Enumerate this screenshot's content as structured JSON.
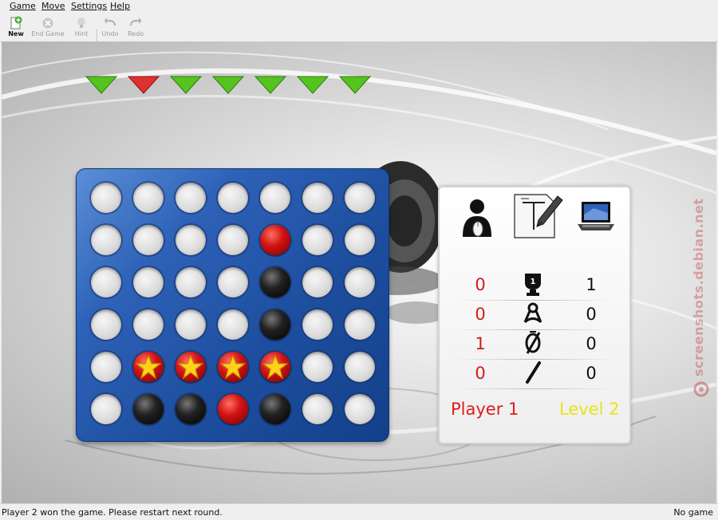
{
  "menu": {
    "items": [
      "Game",
      "Move",
      "Settings",
      "Help"
    ]
  },
  "toolbar": {
    "new_label": "New",
    "end_game_label": "End Game",
    "hint_label": "Hint",
    "undo_label": "Undo",
    "redo_label": "Redo"
  },
  "column_arrows": [
    "green",
    "red",
    "green",
    "green",
    "green",
    "green",
    "green"
  ],
  "colors": {
    "arrow_green": "#55c41e",
    "arrow_red": "#e03030",
    "player_red": "#d21b1b",
    "level_yellow": "#e8e41a",
    "board_blue": "#1d4e9f"
  },
  "board": {
    "rows": 6,
    "columns": 7,
    "cells": [
      [
        "empty",
        "empty",
        "empty",
        "empty",
        "empty",
        "empty",
        "empty"
      ],
      [
        "empty",
        "empty",
        "empty",
        "empty",
        "red",
        "empty",
        "empty"
      ],
      [
        "empty",
        "empty",
        "empty",
        "empty",
        "black",
        "empty",
        "empty"
      ],
      [
        "empty",
        "empty",
        "empty",
        "empty",
        "black",
        "empty",
        "empty"
      ],
      [
        "empty",
        "red-star",
        "red-star",
        "red-star",
        "red-star",
        "empty",
        "empty"
      ],
      [
        "empty",
        "black",
        "black",
        "red",
        "black",
        "empty",
        "empty"
      ]
    ]
  },
  "score_panel": {
    "player_icons": [
      "player-mouse-icon",
      "paper-pencil-icon",
      "computer-laptop-icon"
    ],
    "rows": [
      {
        "left": "0",
        "icon": "trophy-icon",
        "right": "1"
      },
      {
        "left": "0",
        "icon": "loss-ribbon-icon",
        "right": "0"
      },
      {
        "left": "1",
        "icon": "draw-zero-icon",
        "right": "0"
      },
      {
        "left": "0",
        "icon": "slash-icon",
        "right": "0"
      }
    ],
    "player_label": "Player 1",
    "level_label": "Level 2"
  },
  "watermark": "screenshots.debian.net",
  "statusbar": {
    "message": "Player 2 won the game. Please restart next round.",
    "right": "No game"
  }
}
